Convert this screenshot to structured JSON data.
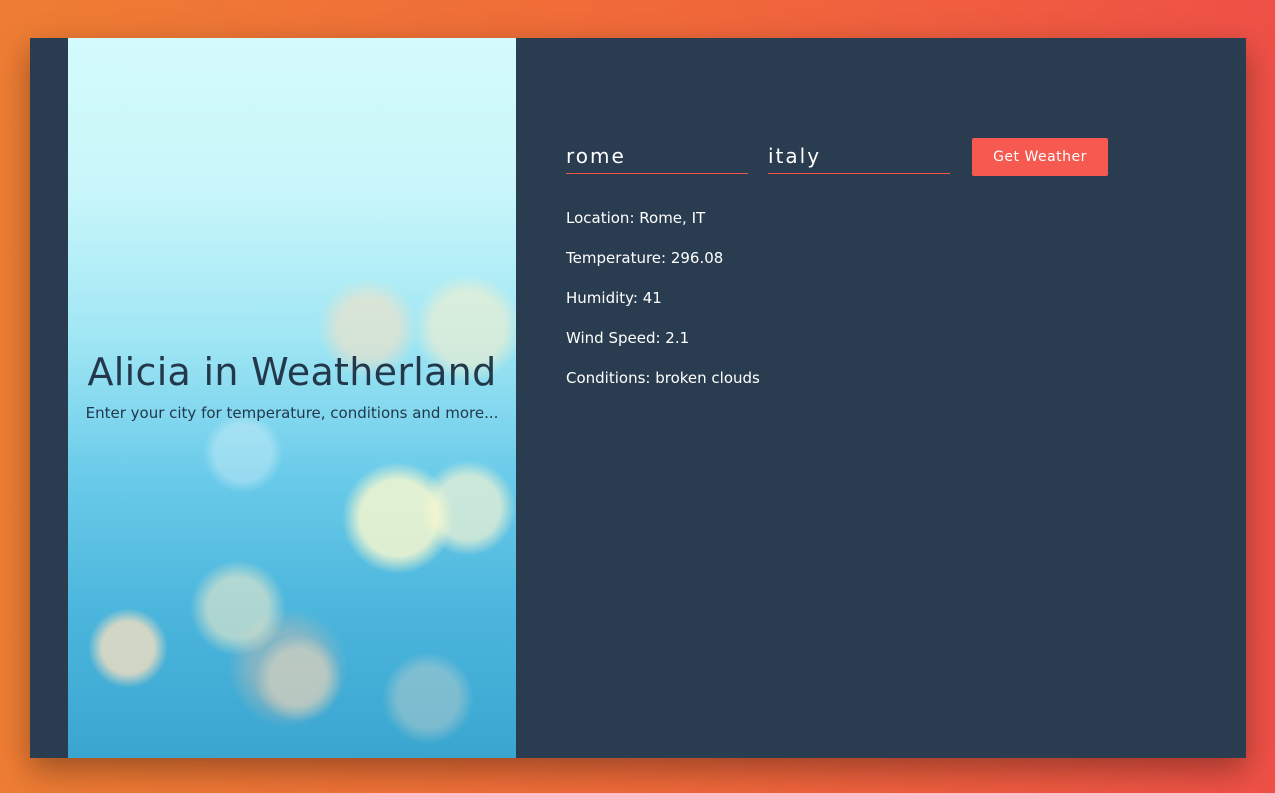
{
  "hero": {
    "title": "Alicia in Weatherland",
    "subtitle": "Enter your city for temperature, conditions and more..."
  },
  "form": {
    "city_value": "rome",
    "country_value": "italy",
    "submit_label": "Get Weather"
  },
  "results": [
    {
      "text": "Location: Rome, IT"
    },
    {
      "text": "Temperature: 296.08"
    },
    {
      "text": "Humidity: 41"
    },
    {
      "text": "Wind Speed: 2.1"
    },
    {
      "text": "Conditions: broken clouds"
    }
  ],
  "colors": {
    "page_gradient_start": "#ee7d33",
    "page_gradient_end": "#ef5046",
    "panel_background": "#2a3d50",
    "accent": "#f5594f",
    "hero_text": "#23384a"
  }
}
